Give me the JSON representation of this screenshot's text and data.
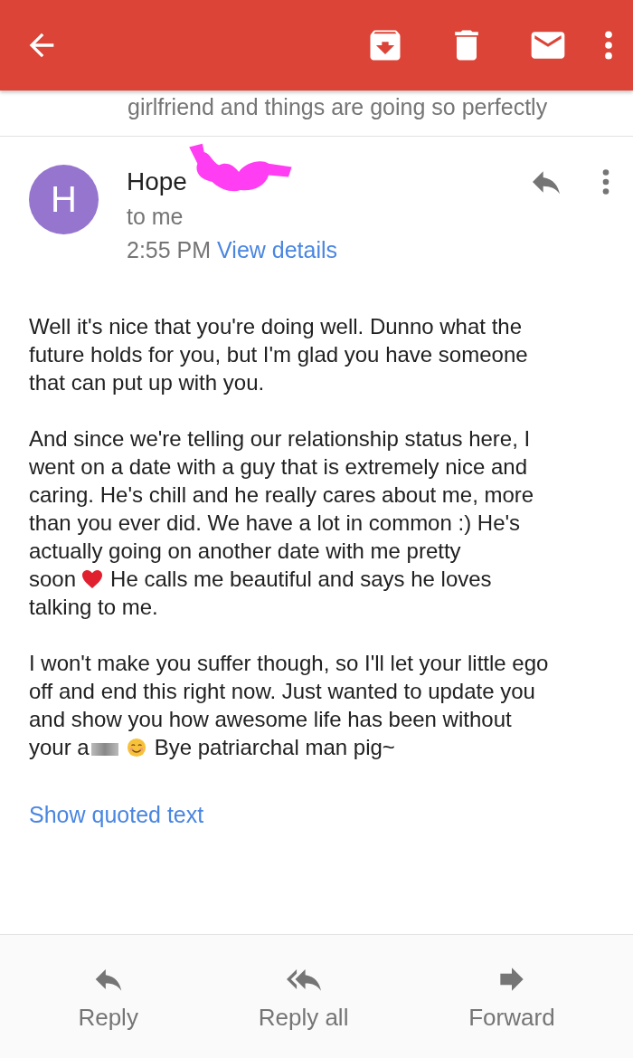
{
  "previous_snippet": "girlfriend and things are going so perfectly",
  "message": {
    "avatar_letter": "H",
    "sender": "Hope",
    "recipient": "to me",
    "time": "2:55 PM",
    "details_link": "View details",
    "body": [
      [
        [
          {
            "kind": "text",
            "text": "Well it's nice that you're doing well. Dunno what the"
          }
        ],
        [
          {
            "kind": "text",
            "text": "future holds for you, but I'm glad you have someone"
          }
        ],
        [
          {
            "kind": "text",
            "text": "that can put up with you."
          }
        ]
      ],
      [
        [
          {
            "kind": "text",
            "text": "And since we're telling our relationship status here, I"
          }
        ],
        [
          {
            "kind": "text",
            "text": "went on a date with a guy that is extremely nice and"
          }
        ],
        [
          {
            "kind": "text",
            "text": "caring. He's chill and he really cares about me, more"
          }
        ],
        [
          {
            "kind": "text",
            "text": "than you ever did. We have a lot in common :) He's"
          }
        ],
        [
          {
            "kind": "text",
            "text": "actually going on another date with me pretty"
          }
        ],
        [
          {
            "kind": "text",
            "text": "soon"
          },
          {
            "kind": "heart"
          },
          {
            "kind": "text",
            "text": "He calls me beautiful and says he loves"
          }
        ],
        [
          {
            "kind": "text",
            "text": "talking to me."
          }
        ]
      ],
      [
        [
          {
            "kind": "text",
            "text": "I won't make you suffer though, so I'll let your little ego"
          }
        ],
        [
          {
            "kind": "text",
            "text": "off and end this right now. Just wanted to update you"
          }
        ],
        [
          {
            "kind": "text",
            "text": "and show you how awesome life has been without"
          }
        ],
        [
          {
            "kind": "text",
            "text": "your a"
          },
          {
            "kind": "redaction"
          },
          {
            "kind": "smile"
          },
          {
            "kind": "text",
            "text": "Bye patriarchal man pig~"
          }
        ]
      ]
    ],
    "show_quoted": "Show quoted text"
  },
  "actions": [
    {
      "kind": "reply",
      "label": "Reply"
    },
    {
      "kind": "reply_all",
      "label": "Reply all"
    },
    {
      "kind": "forward",
      "label": "Forward"
    }
  ]
}
